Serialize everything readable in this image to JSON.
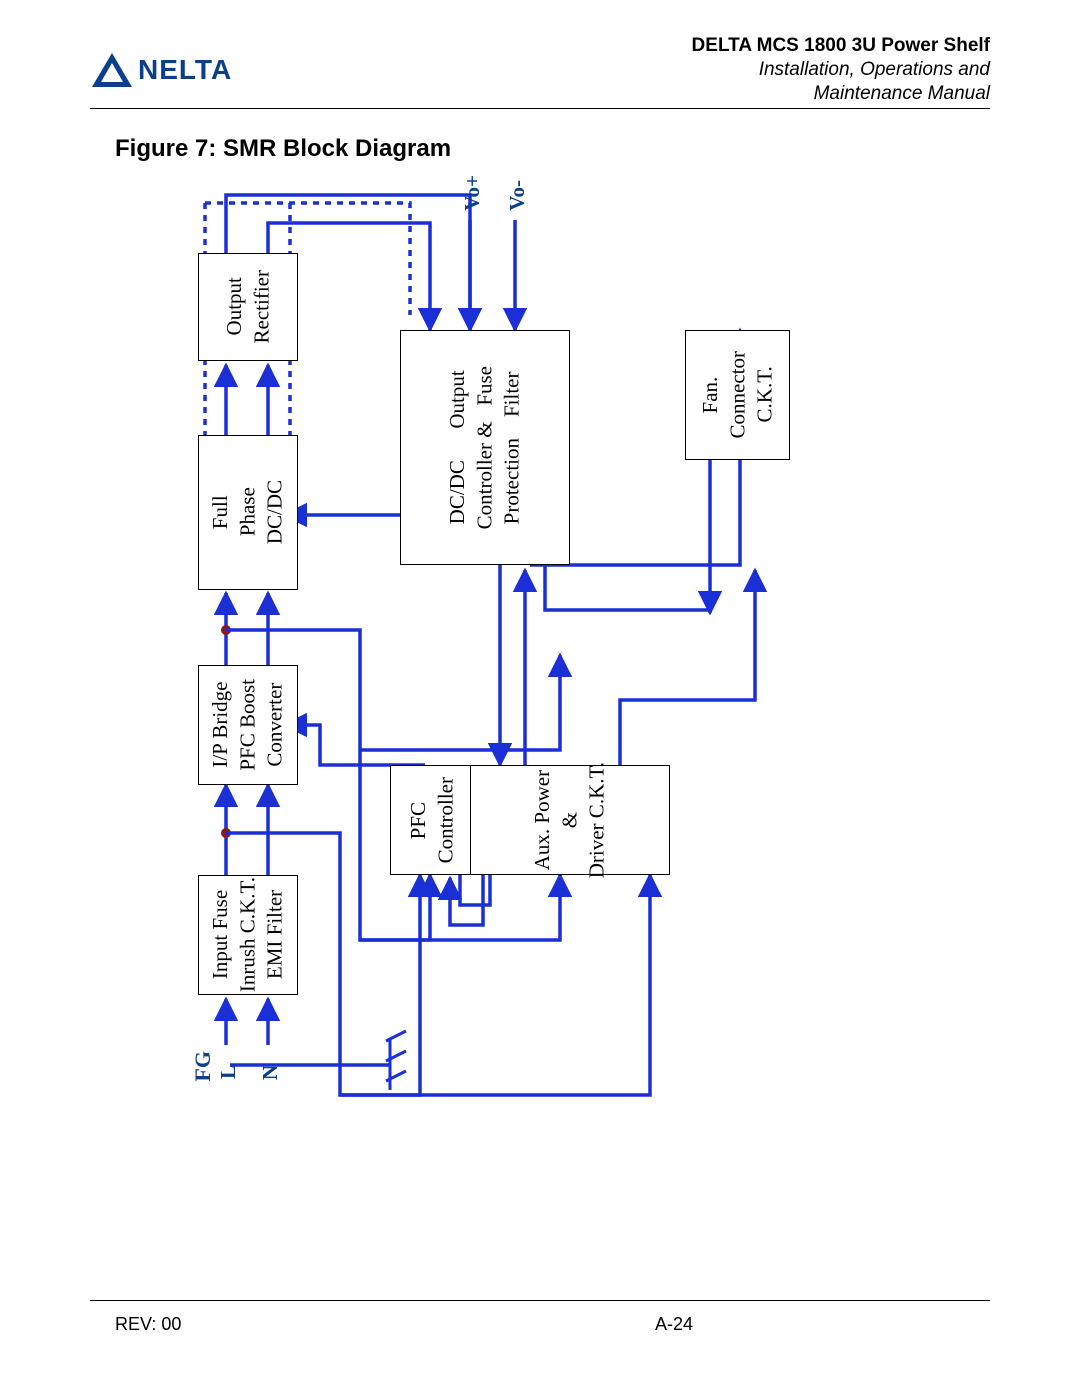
{
  "header": {
    "logo_text": "NELTA",
    "title": "DELTA MCS 1800 3U Power Shelf",
    "subtitle_1": "Installation, Operations and",
    "subtitle_2": "Maintenance Manual"
  },
  "figure": {
    "caption": "Figure 7:   SMR Block Diagram"
  },
  "blocks": {
    "input_filter": "Input Fuse\nInrush C.K.T.\nEMI Filter",
    "pfc_boost": "I/P Bridge\nPFC Boost\nConverter",
    "full_phase": "Full\nPhase\nDC/DC",
    "output_rect": "Output\nRectifier",
    "pfc_ctrl": "PFC\nController",
    "dcdc_ctrl": "DC/DC      Output\nController &   Fuse\nProtection    Filter",
    "aux_power": "Aux. Power\n&\nDriver C.K.T.",
    "fan_conn": "Fan.\nConnector\nC.K.T."
  },
  "labels": {
    "L": "L",
    "N": "N",
    "FG": "FG",
    "Vo_plus": "Vo+",
    "Vo_minus": "Vo-"
  },
  "footer": {
    "rev": "REV: 00",
    "page": "A-24"
  },
  "colors": {
    "wire": "#1a2fd6",
    "brand": "#0a3f8a"
  }
}
